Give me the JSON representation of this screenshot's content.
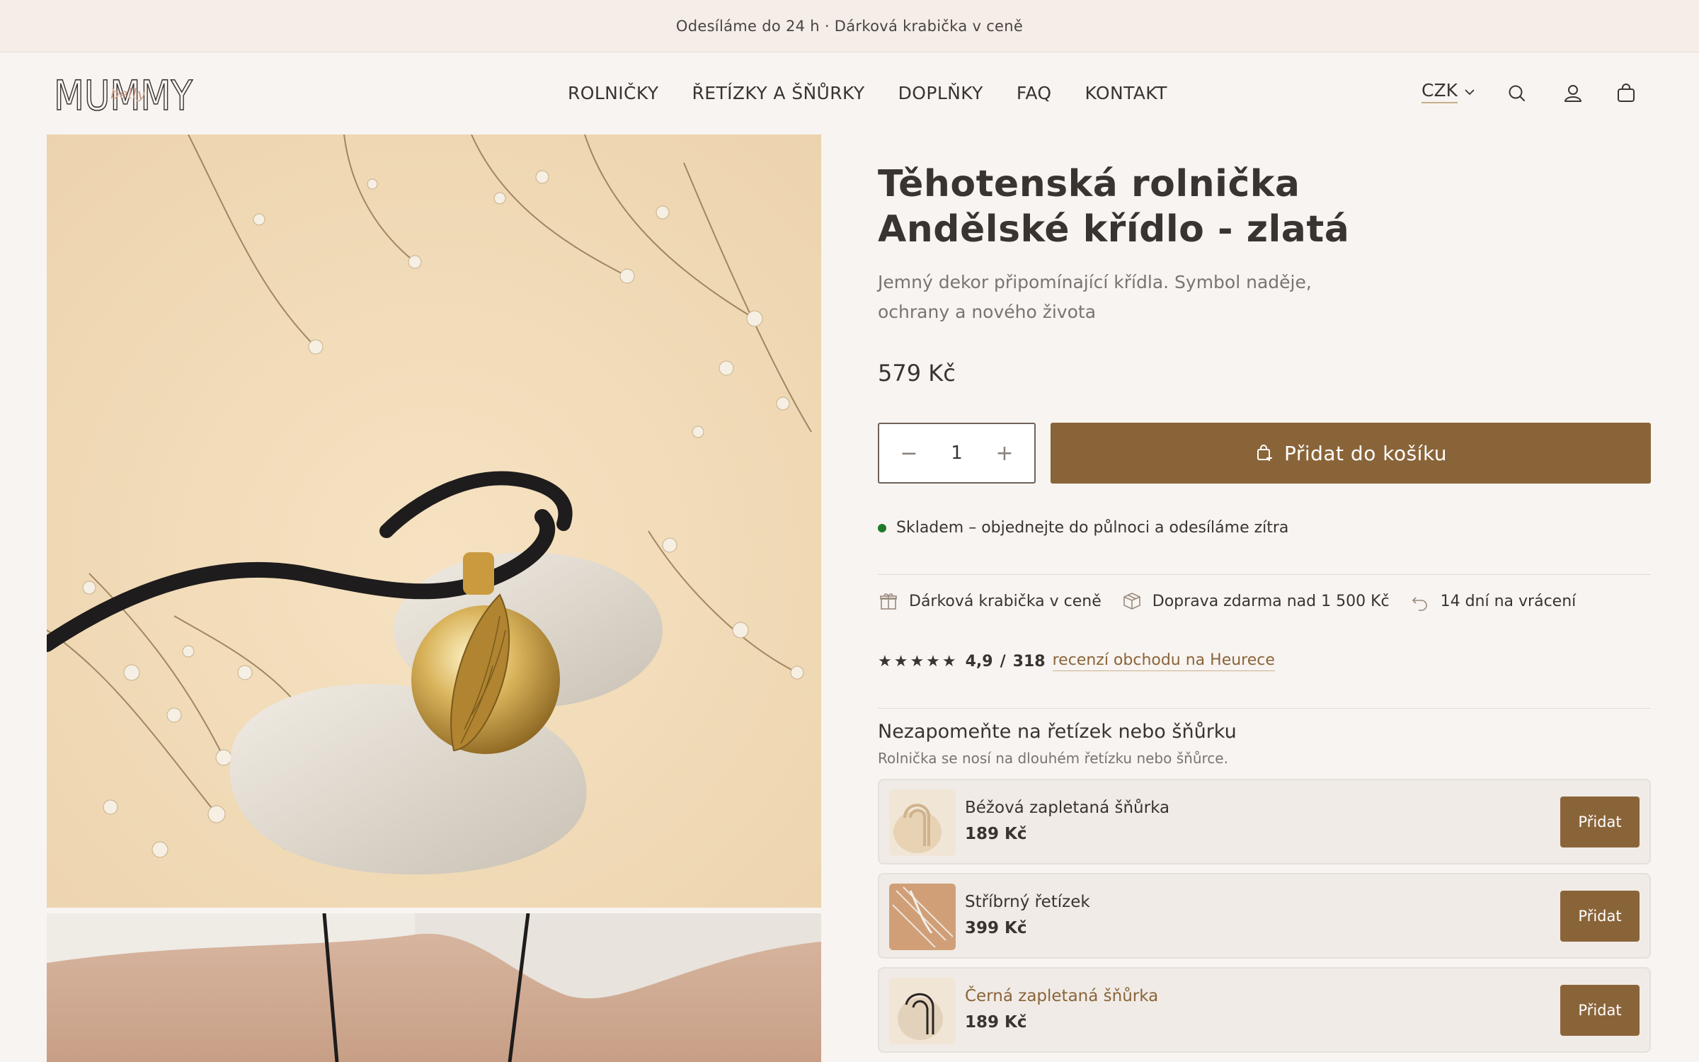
{
  "announcement": "Odesíláme do 24 h · Dárková krabička v ceně",
  "logo": {
    "main": "MUMMY",
    "script": "belly"
  },
  "nav": [
    "ROLNIČKY",
    "ŘETÍZKY A ŠŇŮRKY",
    "DOPLŇKY",
    "FAQ",
    "KONTAKT"
  ],
  "header": {
    "currency": "CZK"
  },
  "product": {
    "title_line1": "Těhotenská rolnička",
    "title_line2": "Andělské křídlo - zlatá",
    "description_line1": "Jemný dekor připomínající křídla. Symbol naděje,",
    "description_line2": "ochrany a nového života",
    "price": "579 Kč",
    "quantity": "1",
    "add_to_cart": "Přidat do košíku",
    "stock": "Skladem – objednejte do půlnoci a odesíláme zítra"
  },
  "perks": [
    {
      "icon": "gift-icon",
      "label": "Dárková krabička v ceně"
    },
    {
      "icon": "package-icon",
      "label": "Doprava zdarma nad 1 500 Kč"
    },
    {
      "icon": "return-icon",
      "label": "14 dní na vrácení"
    }
  ],
  "rating": {
    "stars": "★★★★★",
    "score": "4,9",
    "separator": "/",
    "count": "318",
    "link": "recenzí obchodu na Heurece"
  },
  "upsell": {
    "title": "Nezapomeňte na řetízek nebo šňůrku",
    "subtitle": "Rolnička se nosí na dlouhém řetízku nebo šňůrce.",
    "items": [
      {
        "name": "Béžová zapletaná šňůrka",
        "price": "189 Kč",
        "button": "Přidat"
      },
      {
        "name": "Stříbrný řetízek",
        "price": "399 Kč",
        "button": "Přidat"
      },
      {
        "name": "Černá zapletaná šňůrka",
        "price": "189 Kč",
        "button": "Přidat"
      }
    ]
  },
  "colors": {
    "accent": "#8a6439",
    "background": "#f8f4f1",
    "announcement_bg": "#f5ede7",
    "in_stock": "#1f7a2a"
  }
}
